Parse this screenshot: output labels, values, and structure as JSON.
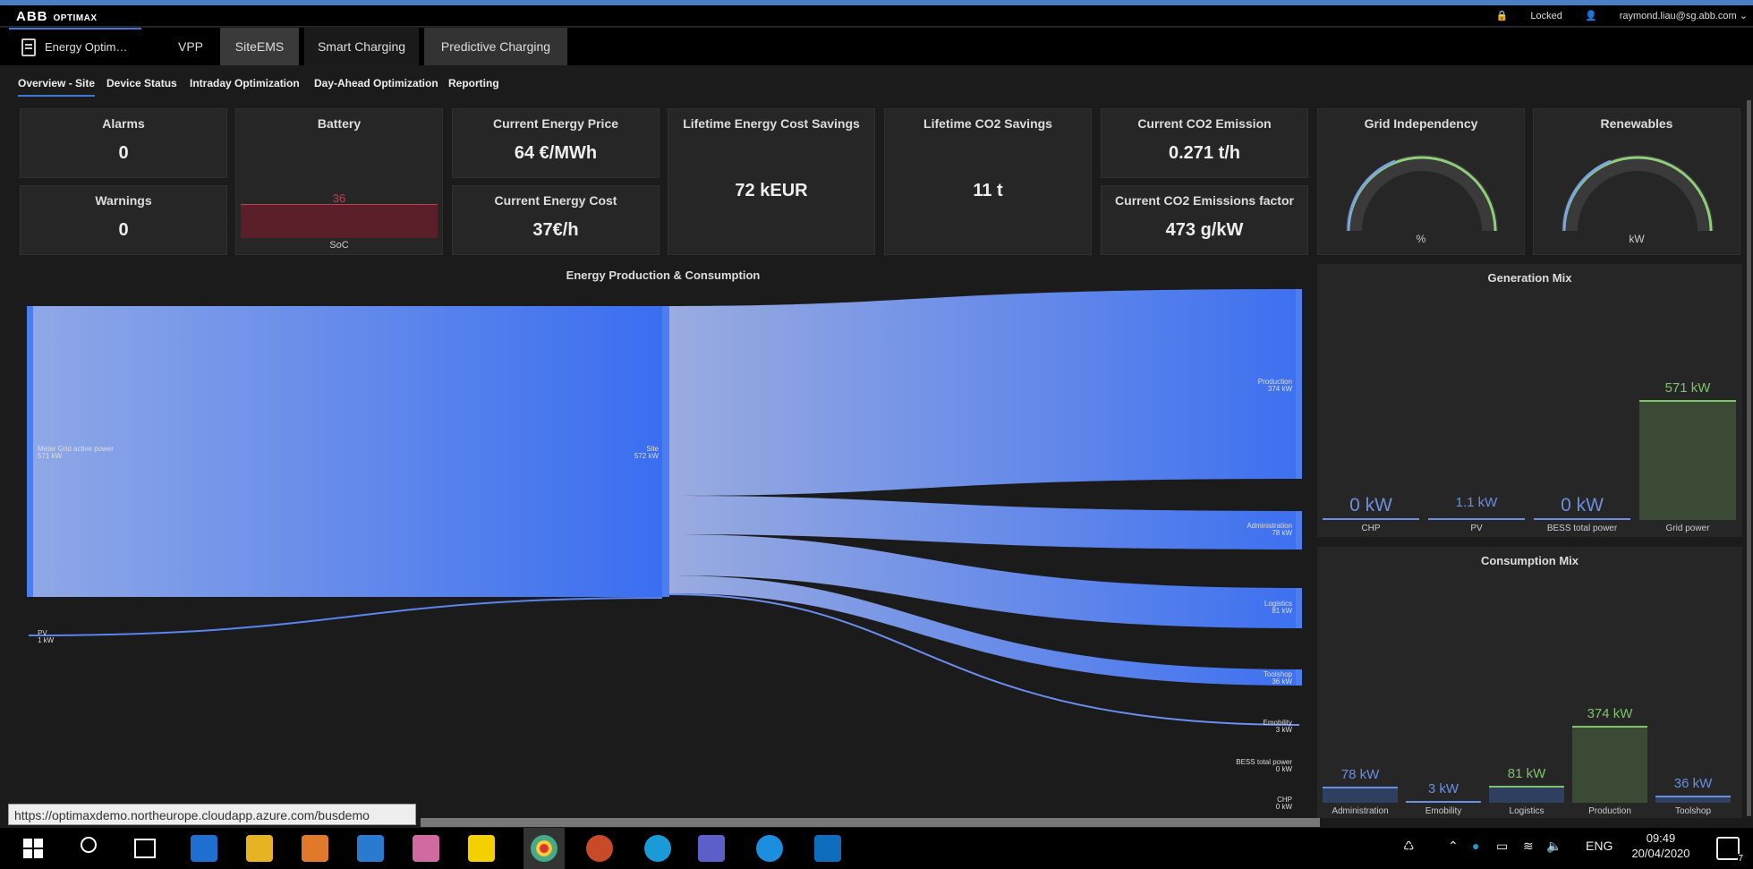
{
  "brand": {
    "logo": "ABB",
    "product": "OPTIMAX",
    "lock_status": "Locked",
    "user": "raymond.liau@sg.abb.com"
  },
  "nav": {
    "home": "Energy Optim…",
    "tabs": [
      "VPP",
      "SiteEMS",
      "Smart Charging",
      "Predictive Charging"
    ],
    "active": "SiteEMS"
  },
  "subnav": {
    "tabs": [
      "Overview - Site",
      "Device Status",
      "Intraday Optimization",
      "Day-Ahead Optimization",
      "Reporting"
    ],
    "active": "Overview - Site"
  },
  "kpi": {
    "alarms": {
      "title": "Alarms",
      "value": "0"
    },
    "warnings": {
      "title": "Warnings",
      "value": "0"
    },
    "battery": {
      "title": "Battery",
      "value": "36",
      "label": "SoC"
    },
    "energy_price": {
      "title": "Current Energy Price",
      "value": "64 €/MWh"
    },
    "energy_cost": {
      "title": "Current Energy Cost",
      "value": "37€/h"
    },
    "lifetime_cost": {
      "title": "Lifetime Energy Cost Savings",
      "value": "72 kEUR"
    },
    "lifetime_co2": {
      "title": "Lifetime CO2 Savings",
      "value": "11 t"
    },
    "co2_emission": {
      "title": "Current CO2 Emission",
      "value": "0.271 t/h"
    },
    "co2_factor": {
      "title": "Current CO2 Emissions factor",
      "value": "473 g/kW"
    },
    "grid_indep": {
      "title": "Grid Independency",
      "unit": "%"
    },
    "renewables": {
      "title": "Renewables",
      "unit": "kW"
    }
  },
  "sankey": {
    "title": "Energy Production & Consumption",
    "nodes": {
      "grid": {
        "name": "Meter Grid active power",
        "value": "571 kW"
      },
      "pv": {
        "name": "PV",
        "value": "1 kW"
      },
      "site": {
        "name": "Site",
        "value": "572 kW"
      },
      "production": {
        "name": "Production",
        "value": "374 kW"
      },
      "administration": {
        "name": "Administration",
        "value": "78 kW"
      },
      "logistics": {
        "name": "Logistics",
        "value": "81 kW"
      },
      "toolshop": {
        "name": "Toolshop",
        "value": "36 kW"
      },
      "emobility": {
        "name": "Emobility",
        "value": "3 kW"
      },
      "bess": {
        "name": "BESS total power",
        "value": "0 kW"
      },
      "chp": {
        "name": "CHP",
        "value": "0 kW"
      }
    }
  },
  "generation_mix": {
    "title": "Generation Mix",
    "chart_data": {
      "type": "bar",
      "categories": [
        "CHP",
        "PV",
        "BESS total power",
        "Grid power"
      ],
      "values": [
        0,
        1.1,
        0,
        571
      ],
      "value_labels": [
        "0 kW",
        "1.1 kW",
        "0 kW",
        "571 kW"
      ]
    }
  },
  "consumption_mix": {
    "title": "Consumption Mix",
    "chart_data": {
      "type": "bar",
      "categories": [
        "Administration",
        "Emobility",
        "Logistics",
        "Production",
        "Toolshop"
      ],
      "values": [
        78,
        3,
        81,
        374,
        36
      ],
      "value_labels": [
        "78 kW",
        "3 kW",
        "81 kW",
        "374 kW",
        "36 kW"
      ]
    }
  },
  "status_url": "https://optimaxdemo.northeurope.cloudapp.azure.com/busdemo",
  "taskbar": {
    "lang": "ENG",
    "time": "09:49",
    "date": "20/04/2020",
    "notif_count": "7"
  }
}
